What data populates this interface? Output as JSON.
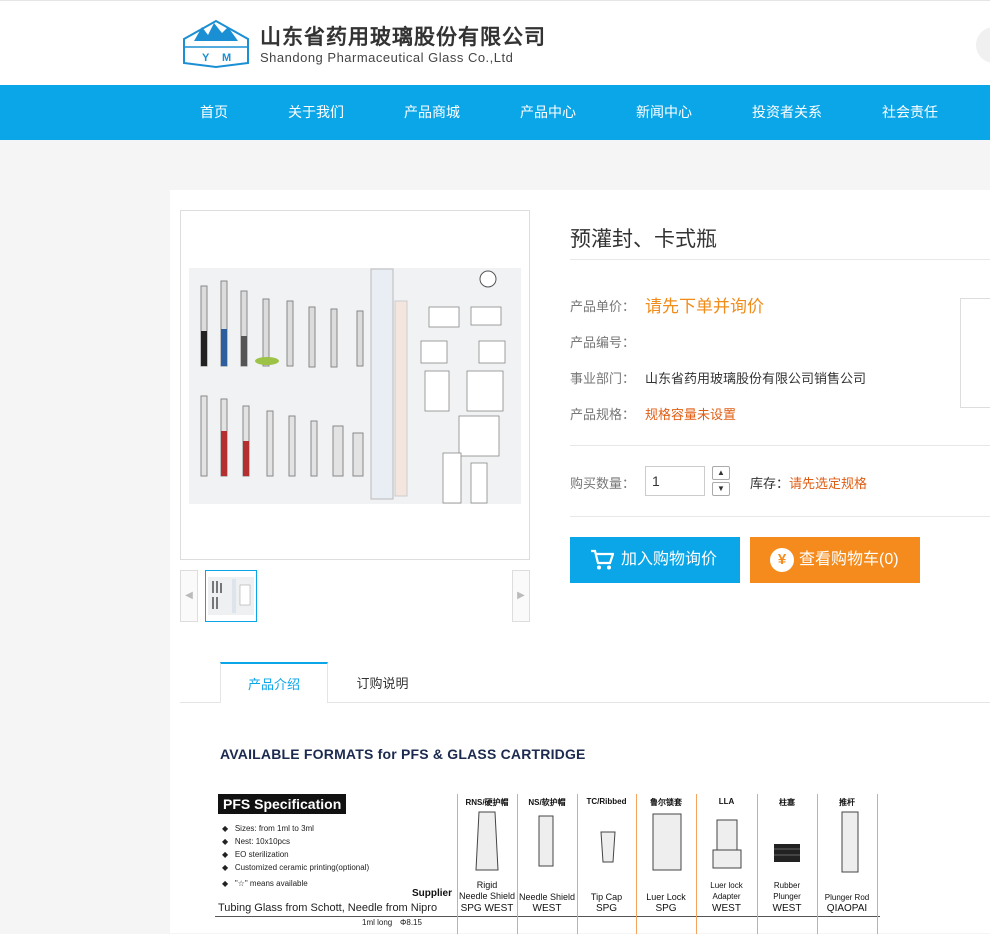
{
  "header": {
    "company_cn": "山东省药用玻璃股份有限公司",
    "company_en": "Shandong Pharmaceutical Glass Co.,Ltd",
    "logo_text": "YM"
  },
  "nav": [
    "首页",
    "关于我们",
    "产品商城",
    "产品中心",
    "新闻中心",
    "投资者关系",
    "社会责任"
  ],
  "product": {
    "title": "预灌封、卡式瓶",
    "price_label": "产品单价：",
    "price_value": "请先下单并询价",
    "code_label": "产品编号：",
    "code_value": "",
    "dept_label": "事业部门：",
    "dept_value": "山东省药用玻璃股份有限公司销售公司",
    "spec_label": "产品规格：",
    "spec_value": "规格容量未设置",
    "qty_label": "购买数量：",
    "qty_value": "1",
    "stock_label": "库存：",
    "stock_value": "请先选定规格",
    "add_cart": "加入购物询价",
    "view_cart": "查看购物车(0)",
    "yen_symbol": "¥"
  },
  "tabs": [
    "产品介绍",
    "订购说明"
  ],
  "spec_sheet": {
    "title": "AVAILABLE FORMATS for PFS & GLASS CARTRIDGE",
    "pfs_title": "PFS Specification",
    "bullets": [
      "Sizes: from 1ml to 3ml",
      "Nest: 10x10pcs",
      "EO sterilization",
      "Customized ceramic printing(optional)",
      "\"☆\" means available"
    ],
    "supplier_label": "Supplier",
    "tubing": "Tubing Glass from Schott, Needle from Nipro",
    "size_row": [
      "1ml long",
      "Φ8.15"
    ],
    "columns": [
      {
        "head": "RNS/硬护帽",
        "sub": "Rigid\nNeedle Shield",
        "supplier": "SPG WEST"
      },
      {
        "head": "NS/软护帽",
        "sub": "Needle Shield",
        "supplier": "WEST"
      },
      {
        "head": "TC/Ribbed",
        "sub": "Tip Cap",
        "supplier": "SPG"
      },
      {
        "head": "鲁尔锁套",
        "sub": "Luer Lock",
        "supplier": "SPG"
      },
      {
        "head": "LLA",
        "sub": "Luer lock\nAdapter",
        "supplier": "WEST"
      },
      {
        "head": "柱塞",
        "sub": "Rubber\nPlunger",
        "supplier": "WEST"
      },
      {
        "head": "推杆",
        "sub": "Plunger Rod",
        "supplier": "QIAOPAI"
      }
    ]
  },
  "colors": {
    "nav_blue": "#0aa6e8",
    "orange_button": "#f58b1c",
    "price_orange": "#f08c1a",
    "highlight_orange": "#e05e14"
  }
}
